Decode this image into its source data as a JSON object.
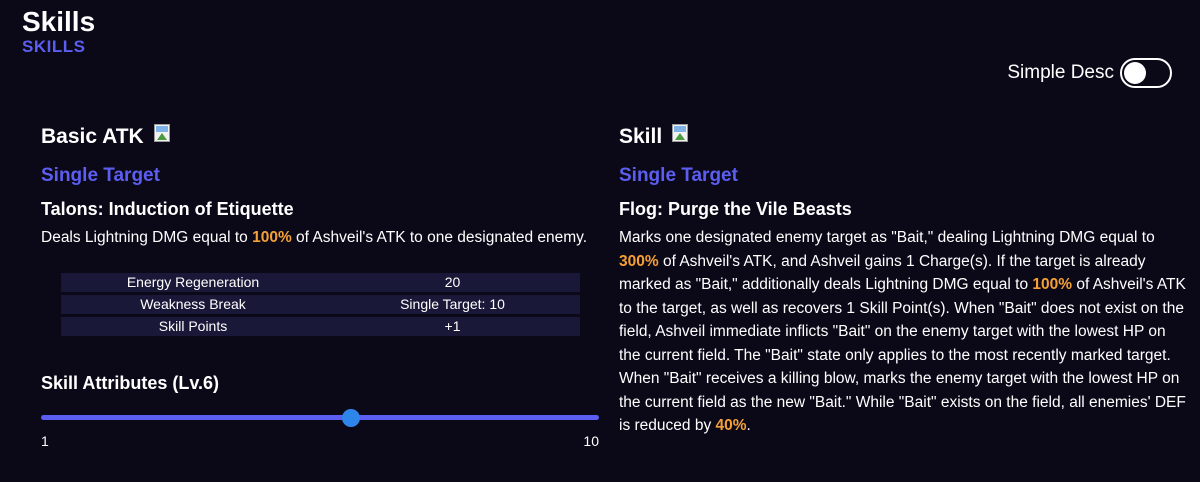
{
  "header": {
    "title": "Skills",
    "subtitle": "SKILLS"
  },
  "toggle": {
    "label": "Simple Desc",
    "checked": false
  },
  "basic": {
    "title": "Basic ATK",
    "target": "Single Target",
    "name": "Talons: Induction of Etiquette",
    "desc": [
      "Deals Lightning DMG equal to ",
      "100%",
      " of Ashveil's ATK to one designated enemy."
    ],
    "stats": [
      {
        "key": "Energy Regeneration",
        "value": "20"
      },
      {
        "key": "Weakness Break",
        "value": "Single Target: 10"
      },
      {
        "key": "Skill Points",
        "value": "+1"
      }
    ],
    "attributes_title": "Skill Attributes (Lv.6)",
    "slider": {
      "min": "1",
      "max": "10",
      "value": 6
    }
  },
  "skill": {
    "title": "Skill",
    "target": "Single Target",
    "name": "Flog: Purge the Vile Beasts",
    "desc": [
      "Marks one designated enemy target as \"Bait,\" dealing Lightning DMG equal to ",
      "300%",
      " of Ashveil's ATK, and Ashveil gains 1 Charge(s). If the target is already marked as \"Bait,\" additionally deals Lightning DMG equal to ",
      "100%",
      " of Ashveil's ATK to the target, as well as recovers 1 Skill Point(s). When \"Bait\" does not exist on the field, Ashveil immediate inflicts \"Bait\" on the enemy target with the lowest HP on the current field. The \"Bait\" state only applies to the most recently marked target. When \"Bait\" receives a killing blow, marks the enemy target with the lowest HP on the current field as the new \"Bait.\" While \"Bait\" exists on the field, all enemies' DEF is reduced by ",
      "40%",
      "."
    ]
  },
  "colors": {
    "background": "#0b0918",
    "accent": "#5b5ef0",
    "highlight": "#f5a035",
    "row": "#1a1838",
    "thumb": "#2e86ea"
  },
  "icons": {
    "skill_image": "broken-image-icon"
  }
}
